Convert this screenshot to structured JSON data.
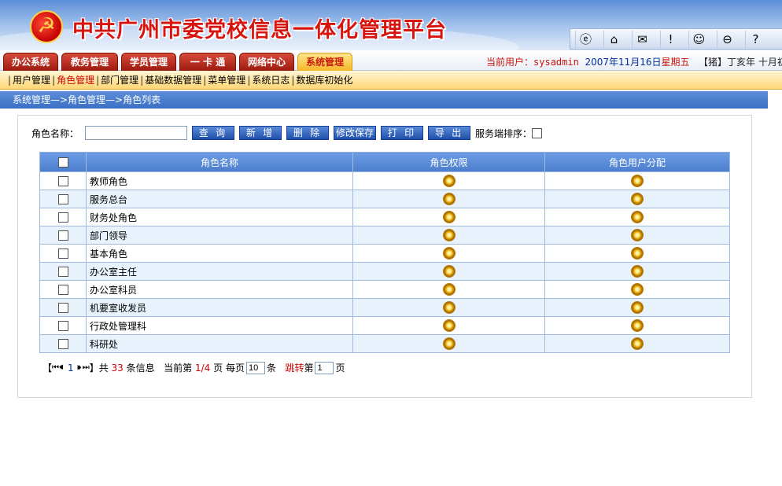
{
  "header": {
    "title": "中共广州市委党校信息一体化管理平台",
    "emblem": "☭",
    "tool_icons": [
      "ie-icon",
      "home-icon",
      "mail-icon",
      "alert-icon",
      "smile-icon",
      "stop-icon",
      "user-help-icon"
    ],
    "tool_glyphs": [
      "ⓔ",
      "⌂",
      "✉",
      "!",
      "☺",
      "⊖",
      "?"
    ]
  },
  "menu": {
    "tabs": [
      {
        "label": "办公系统"
      },
      {
        "label": "教务管理"
      },
      {
        "label": "学员管理"
      },
      {
        "label": "一 卡 通"
      },
      {
        "label": "网络中心"
      },
      {
        "label": "系统管理"
      }
    ]
  },
  "user": {
    "prefix": "当前用户：",
    "username": "sysadmin",
    "date": "2007年11月16日",
    "weekday": "星期五",
    "lunar": "【猪】丁亥年 十月初七"
  },
  "submenu": {
    "items": [
      "用户管理",
      "角色管理",
      "部门管理",
      "基础数据管理",
      "菜单管理",
      "系统日志",
      "数据库初始化"
    ]
  },
  "breadcrumb": "系统管理—>角色管理—>角色列表",
  "search": {
    "label": "角色名称：",
    "value": "",
    "buttons": {
      "query": "查 询",
      "add": "新 增",
      "delete": "删 除",
      "save": "修改保存",
      "print": "打 印",
      "export": "导 出"
    },
    "server_sort_label": "服务端排序："
  },
  "table": {
    "headers": {
      "name": "角色名称",
      "permission": "角色权限",
      "assign": "角色用户分配"
    },
    "rows": [
      {
        "name": "教师角色"
      },
      {
        "name": "服务总台"
      },
      {
        "name": "财务处角色"
      },
      {
        "name": "部门领导"
      },
      {
        "name": "基本角色"
      },
      {
        "name": "办公室主任"
      },
      {
        "name": "办公室科员"
      },
      {
        "name": "机要室收发员"
      },
      {
        "name": "行政处管理科"
      },
      {
        "name": "科研处"
      }
    ]
  },
  "pager": {
    "open_bracket": "【",
    "first": "⏮",
    "prev": "⏴⏴",
    "current_link": "1",
    "next": "⏵⏵",
    "last": "⏭",
    "close_bracket": "】",
    "total_prefix": "共",
    "total": "33",
    "total_suffix": "条信息",
    "current_prefix": "当前第",
    "current": "1/4",
    "current_suffix": "页",
    "per_page_prefix": "每页",
    "per_page": "10",
    "per_page_suffix": "条",
    "jump_prefix": "跳转",
    "jump_mid": "第",
    "jump_value": "1",
    "jump_suffix": "页"
  }
}
